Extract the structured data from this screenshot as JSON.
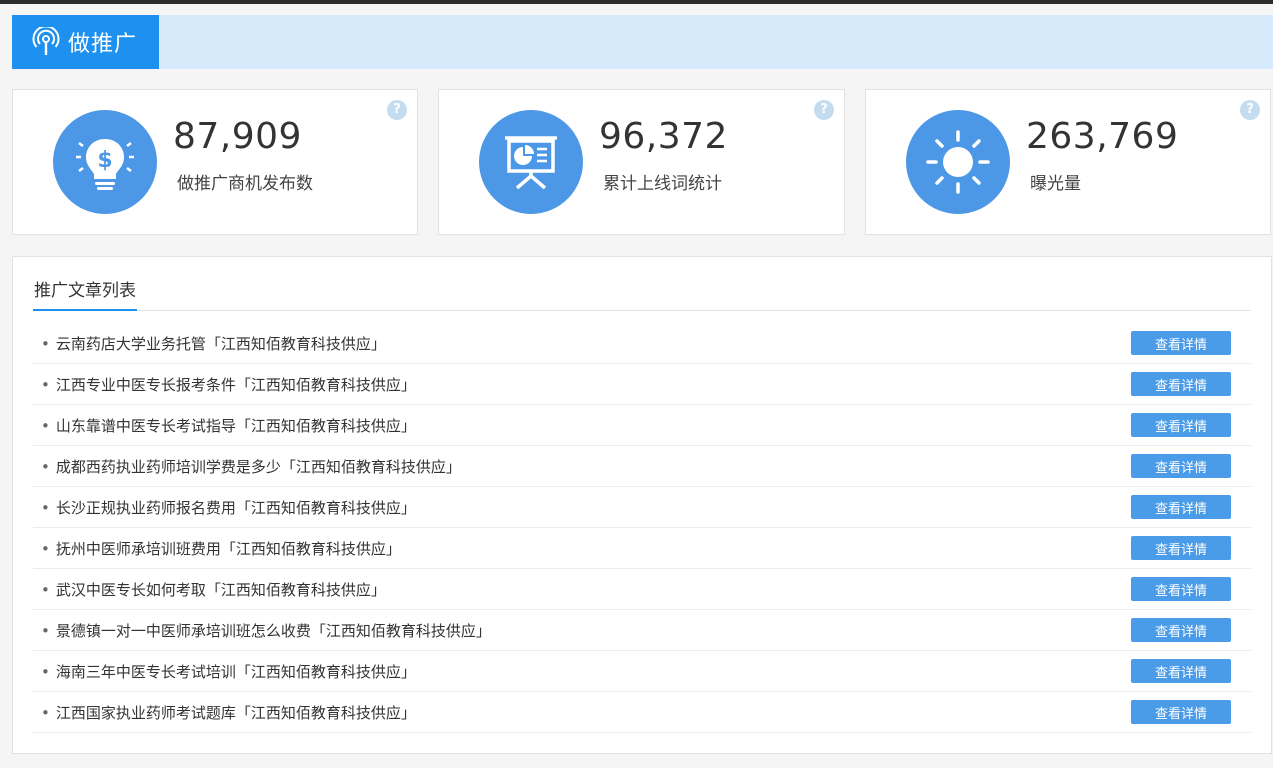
{
  "header": {
    "tab_label": "做推广",
    "tab_icon": "broadcast-icon",
    "accent_color": "#1e90f0"
  },
  "stats": [
    {
      "value": "87,909",
      "label": "做推广商机发布数",
      "icon": "lightbulb-dollar-icon",
      "help": "?"
    },
    {
      "value": "96,372",
      "label": "累计上线词统计",
      "icon": "presentation-board-icon",
      "help": "?"
    },
    {
      "value": "263,769",
      "label": "曝光量",
      "icon": "sun-icon",
      "help": "?"
    }
  ],
  "panel": {
    "tab_label": "推广文章列表",
    "bullet": "•",
    "detail_label": "查看详情",
    "articles": [
      "云南药店大学业务托管「江西知佰教育科技供应」",
      "江西专业中医专长报考条件「江西知佰教育科技供应」",
      "山东靠谱中医专长考试指导「江西知佰教育科技供应」",
      "成都西药执业药师培训学费是多少「江西知佰教育科技供应」",
      "长沙正规执业药师报名费用「江西知佰教育科技供应」",
      "抚州中医师承培训班费用「江西知佰教育科技供应」",
      "武汉中医专长如何考取「江西知佰教育科技供应」",
      "景德镇一对一中医师承培训班怎么收费「江西知佰教育科技供应」",
      "海南三年中医专长考试培训「江西知佰教育科技供应」",
      "江西国家执业药师考试题库「江西知佰教育科技供应」"
    ]
  }
}
